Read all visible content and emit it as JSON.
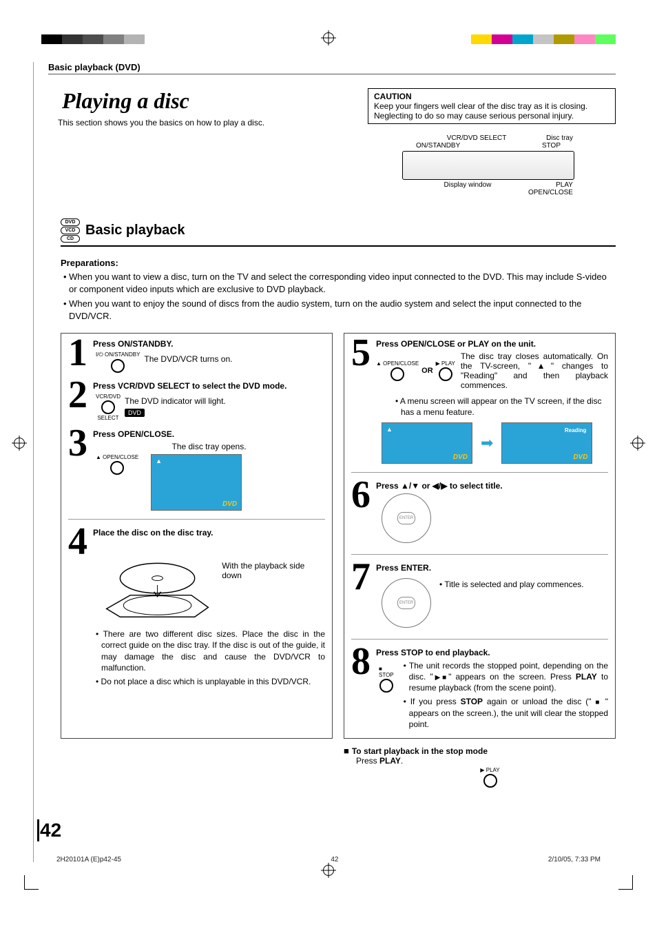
{
  "page": {
    "number": "42"
  },
  "print_bars": {
    "left_colors": [
      "#000000",
      "#333333",
      "#4d4d4d",
      "#808080",
      "#b3b3b3"
    ],
    "right_colors": [
      "#ffd800",
      "#d40093",
      "#00a5ce",
      "#c4c4c4",
      "#af9a00",
      "#ff86c2",
      "#5cff5c"
    ]
  },
  "header": {
    "section": "Basic playback (DVD)",
    "title": "Playing a disc",
    "subtitle": "This section shows you the basics on how to play a disc.",
    "caution_title": "CAUTION",
    "caution_body": "Keep your fingers well clear of the disc tray as it is closing. Neglecting to do so may cause serious personal injury."
  },
  "device": {
    "label_vcrdvd": "VCR/DVD SELECT",
    "label_tray": "Disc tray",
    "label_onstandby": "ON/STANDBY",
    "label_stop": "STOP",
    "label_display": "Display window",
    "label_play": "PLAY",
    "label_openclose": "OPEN/CLOSE"
  },
  "basic_playback": {
    "badges": [
      "DVD",
      "VCD",
      "CD"
    ],
    "title": "Basic playback",
    "preparations_title": "Preparations:",
    "prep_1": "• When you want to view a disc, turn on the TV and select the corresponding video input connected to the DVD. This may include S-video or component video inputs which are exclusive to DVD playback.",
    "prep_2": "• When you want to enjoy the sound of discs from the audio system, turn on the audio system and select the input connected to the DVD/VCR."
  },
  "steps": {
    "s1": {
      "num": "1",
      "head": "Press ON/STANDBY.",
      "desc": "The DVD/VCR turns on.",
      "btn_label": "I/⏻ ON/STANDBY"
    },
    "s2": {
      "num": "2",
      "head": "Press VCR/DVD SELECT to select the DVD mode.",
      "desc": "The DVD indicator will light.",
      "btn_top": "VCR/DVD",
      "btn_bottom": "SELECT",
      "chip": "DVD"
    },
    "s3": {
      "num": "3",
      "head": "Press OPEN/CLOSE.",
      "desc": "The disc tray opens.",
      "btn_label": "▲ OPEN/CLOSE",
      "screen_eject": "▲",
      "screen_dvd": "DVD"
    },
    "s4": {
      "num": "4",
      "head": "Place the disc on the disc tray.",
      "caption": "With the playback side down",
      "note1": "• There are two different disc sizes. Place the disc in the correct guide on the disc tray. If the disc is out of the guide, it may damage the disc and cause the DVD/VCR to malfunction.",
      "note2": "• Do not place a disc which is unplayable in this DVD/VCR."
    },
    "s5": {
      "num": "5",
      "head": "Press OPEN/CLOSE or PLAY on the unit.",
      "desc": "The disc tray closes automatically. On the TV-screen, \"▲\" changes to \"Reading\" and then playback commences.",
      "btn_a": "▲ OPEN/CLOSE",
      "or": "OR",
      "btn_b": "▶ PLAY",
      "menu_note": "• A menu screen will appear on the TV screen, if the disc has a menu feature.",
      "screen_a_eject": "▲",
      "screen_a_dvd": "DVD",
      "screen_b_reading": "Reading",
      "screen_b_dvd": "DVD"
    },
    "s6": {
      "num": "6",
      "head": "Press ▲/▼ or ◀/▶ to select title.",
      "pad_center": "ENTER"
    },
    "s7": {
      "num": "7",
      "head": "Press ENTER.",
      "desc": "• Title is selected and play commences.",
      "pad_center": "ENTER"
    },
    "s8": {
      "num": "8",
      "head": "Press STOP to end playback.",
      "btn_label": "■ STOP",
      "note1": "• The unit records the stopped point, depending on the disc. \"▶■\" appears on the screen. Press PLAY to resume playback (from the scene point).",
      "note2": "• If you press STOP again or unload the disc (\" ■ \" appears on the screen.), the unit will clear the stopped point.",
      "bold_play": "PLAY",
      "bold_stop": "STOP"
    }
  },
  "tail": {
    "title": "To start playback in the stop mode",
    "line": "Press PLAY.",
    "bold_play": "PLAY",
    "btn_label": "▶ PLAY"
  },
  "footer": {
    "left": "2H20101A (E)p42-45",
    "center": "42",
    "right": "2/10/05, 7:33 PM"
  }
}
